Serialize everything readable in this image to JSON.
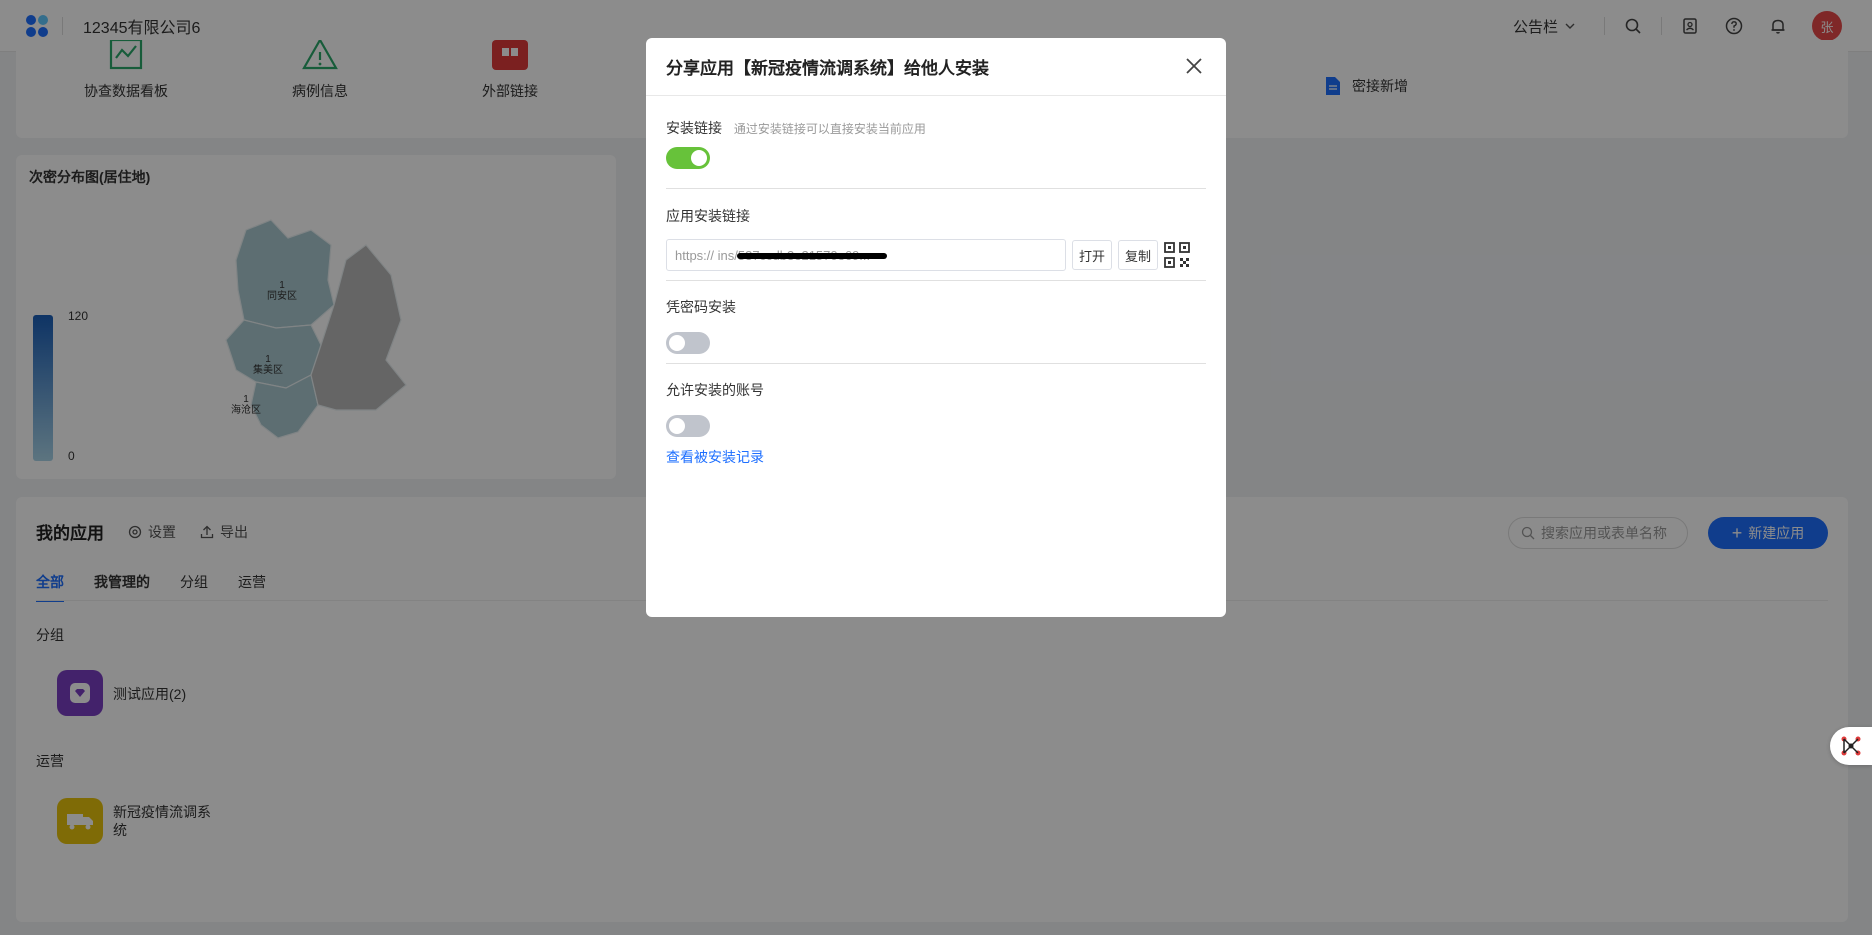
{
  "topbar": {
    "company": "12345有限公司6",
    "notice": "公告栏",
    "icons": [
      "search-icon",
      "contacts-icon",
      "help-icon",
      "bell-icon"
    ],
    "avatar": "张"
  },
  "quick_links": {
    "items": [
      {
        "label": "协查数据看板",
        "icon": "chart-icon",
        "color": "#2aa86b"
      },
      {
        "label": "病例信息",
        "icon": "warning-icon",
        "color": "#2aa86b"
      },
      {
        "label": "外部链接",
        "icon": "link-icon",
        "color": "#e03b3b"
      }
    ],
    "doc_item": {
      "label": "密接新增",
      "icon": "document-icon",
      "color": "#1e6fff"
    }
  },
  "map": {
    "title": "次密分布图(居住地)",
    "legend_max": "120",
    "legend_min": "0",
    "regions": [
      {
        "count": "1",
        "name": "同安区"
      },
      {
        "count": "1",
        "name": "集美区"
      },
      {
        "count": "1",
        "name": "海沧区"
      }
    ]
  },
  "apps": {
    "title": "我的应用",
    "settings_label": "设置",
    "export_label": "导出",
    "search_placeholder": "搜索应用或表单名称",
    "new_app_label": "新建应用",
    "tabs": [
      "全部",
      "我管理的",
      "分组",
      "运营"
    ],
    "groups": [
      {
        "label": "分组",
        "apps": [
          {
            "name": "测试应用(2)",
            "icon": "diamond-icon",
            "color": "#7b3fc4"
          }
        ]
      },
      {
        "label": "运营",
        "apps": [
          {
            "name": "新冠疫情流调系统",
            "icon": "truck-icon",
            "color": "#e8c30c"
          }
        ]
      }
    ]
  },
  "modal": {
    "title": "分享应用【新冠疫情流调系统】给他人安装",
    "install_link_label": "安装链接",
    "install_link_hint": "通过安装链接可以直接安装当前应用",
    "install_link_enabled": true,
    "app_link_label": "应用安装链接",
    "app_link_value": "https://                                      ins/537ccdb3e21570e69...",
    "open_label": "打开",
    "copy_label": "复制",
    "password_label": "凭密码安装",
    "password_enabled": false,
    "allowed_accounts_label": "允许安装的账号",
    "allowed_accounts_enabled": false,
    "view_records_label": "查看被安装记录"
  }
}
